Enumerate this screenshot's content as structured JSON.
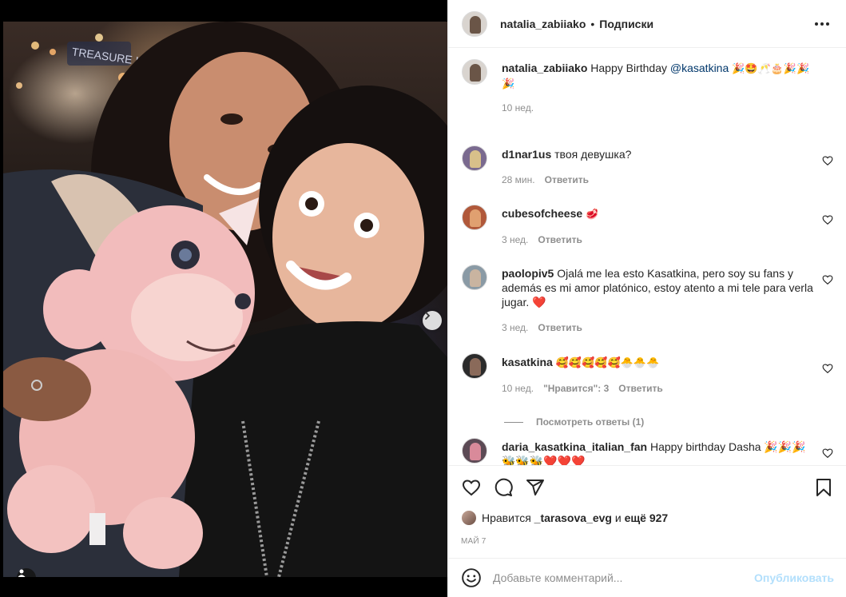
{
  "colors": {
    "text": "#262626",
    "muted": "#8e8e8e",
    "mention": "#00376b",
    "post_disabled": "#b2dffc",
    "heart_red": "#ed4956"
  },
  "post": {
    "author": "natalia_zabiiako",
    "separator": "•",
    "follow_label": "Подписки",
    "more_icon": "more-horizontal-icon",
    "carousel": {
      "slides": 3,
      "active_slide": 1
    }
  },
  "caption": {
    "user": "natalia_zabiiako",
    "text": "Happy Birthday",
    "mention": "@kasatkina",
    "emojis": "🎉🤩🥂🎂🎉🎉🎉",
    "time": "10 нед."
  },
  "comments": [
    {
      "user": "d1nar1us",
      "text": "твоя девушка?",
      "time": "28 мин.",
      "reply": "Ответить",
      "avatar_color": "#7a6a8f"
    },
    {
      "user": "cubesofcheese",
      "text": "🥩",
      "time": "3 нед.",
      "reply": "Ответить",
      "avatar_color": "#b0583a"
    },
    {
      "user": "paolopiv5",
      "text": "Ojalá me lea esto Kasatkina, pero soy su fans y además es mi amor platónico, estoy atento a mi tele para verla jugar. ❤️",
      "time": "3 нед.",
      "reply": "Ответить",
      "avatar_color": "#8a9aa5"
    },
    {
      "user": "kasatkina",
      "text": "🥰🥰🥰🥰🥰🐣🐣🐣",
      "time": "10 нед.",
      "likes": "\"Нравится\": 3",
      "reply": "Ответить",
      "avatar_color": "#2b2b2b"
    },
    {
      "user": "daria_kasatkina_italian_fan",
      "text": "Happy birthday Dasha 🎉🎉🎉🐝🐝🐝❤️❤️❤️",
      "avatar_color": "#5c4a55"
    }
  ],
  "view_replies": "Посмотреть ответы (1)",
  "likes": {
    "prefix": "Нравится",
    "user": "_tarasova_evg",
    "connector": "и",
    "count": "ещё 927"
  },
  "date": "май 7",
  "add_comment": {
    "placeholder": "Добавьте комментарий...",
    "post_label": "Опубликовать"
  }
}
